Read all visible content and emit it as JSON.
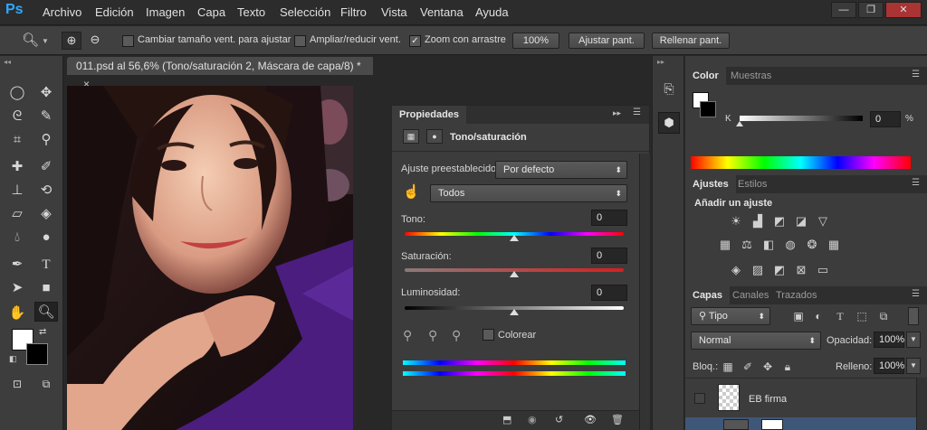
{
  "app": {
    "logo": "Ps"
  },
  "menu": [
    "Archivo",
    "Edición",
    "Imagen",
    "Capa",
    "Texto",
    "Selección",
    "Filtro",
    "Vista",
    "Ventana",
    "Ayuda"
  ],
  "window_controls": {
    "minimize": "—",
    "restore": "❐",
    "close": "✕"
  },
  "options": {
    "resize_windows": "Cambiar tamaño vent. para ajustar",
    "zoom_all": "Ampliar/reducir vent.",
    "scrubby_zoom": "Zoom con arrastre",
    "btn_100": "100%",
    "btn_fit": "Ajustar pant.",
    "btn_fill": "Rellenar pant."
  },
  "document": {
    "tab_title": "011.psd al 56,6% (Tono/saturación 2, Máscara de capa/8) *",
    "close": "×"
  },
  "properties": {
    "title": "Propiedades",
    "adjustment_name": "Tono/saturación",
    "preset_label": "Ajuste preestablecido:",
    "preset_value": "Por defecto",
    "channel_value": "Todos",
    "hue_label": "Tono:",
    "hue_value": "0",
    "hue_slider": 0.5,
    "sat_label": "Saturación:",
    "sat_value": "0",
    "sat_slider": 0.5,
    "light_label": "Luminosidad:",
    "light_value": "0",
    "light_slider": 0.5,
    "colorize_label": "Colorear"
  },
  "color_panel": {
    "tabs": [
      "Color",
      "Muestras"
    ],
    "channel": "K",
    "value": "0",
    "unit": "%",
    "slider": 0
  },
  "adjustments_panel": {
    "tabs": [
      "Ajustes",
      "Estilos"
    ],
    "heading": "Añadir un ajuste"
  },
  "layers_panel": {
    "tabs": [
      "Capas",
      "Canales",
      "Trazados"
    ],
    "filter": "Tipo",
    "blend_mode": "Normal",
    "opacity_label": "Opacidad:",
    "opacity_value": "100%",
    "lock_label": "Bloq.:",
    "fill_label": "Relleno:",
    "fill_value": "100%",
    "layers": [
      {
        "name": "EB firma"
      }
    ]
  },
  "colors": {
    "accent": "#31a8ff",
    "panel": "#3c3c3c",
    "dark": "#282828"
  }
}
